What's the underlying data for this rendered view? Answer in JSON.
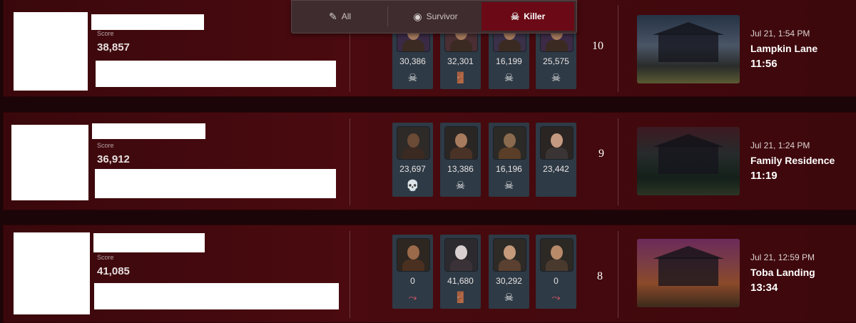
{
  "tabs": [
    {
      "label": "All",
      "icon": "all-icon",
      "active": false
    },
    {
      "label": "Survivor",
      "icon": "survivor-icon",
      "active": false
    },
    {
      "label": "Killer",
      "icon": "killer-icon",
      "active": true
    }
  ],
  "matches": [
    {
      "score_label": "Score",
      "score": "38,857",
      "rank": "10",
      "survivors": [
        {
          "points": "30,386",
          "status_icon": "sacrificed-icon",
          "status": "☠"
        },
        {
          "points": "32,301",
          "status_icon": "escaped-icon",
          "status": "🚪"
        },
        {
          "points": "16,199",
          "status_icon": "sacrificed-icon",
          "status": "☠"
        },
        {
          "points": "25,575",
          "status_icon": "sacrificed-icon",
          "status": "☠"
        }
      ],
      "date": "Jul 21, 1:54 PM",
      "map": "Lampkin Lane",
      "duration": "11:56"
    },
    {
      "score_label": "Score",
      "score": "36,912",
      "rank": "9",
      "survivors": [
        {
          "points": "23,697",
          "status_icon": "killed-icon",
          "status": "💀"
        },
        {
          "points": "13,386",
          "status_icon": "sacrificed-icon",
          "status": "☠"
        },
        {
          "points": "16,196",
          "status_icon": "sacrificed-icon",
          "status": "☠"
        },
        {
          "points": "23,442",
          "status_icon": "",
          "status": ""
        }
      ],
      "date": "Jul 21, 1:24 PM",
      "map": "Family Residence",
      "duration": "11:19"
    },
    {
      "score_label": "Score",
      "score": "41,085",
      "rank": "8",
      "survivors": [
        {
          "points": "0",
          "status_icon": "disconnected-icon",
          "status": "⤳"
        },
        {
          "points": "41,680",
          "status_icon": "escaped-icon",
          "status": "🚪"
        },
        {
          "points": "30,292",
          "status_icon": "sacrificed-icon",
          "status": "☠"
        },
        {
          "points": "0",
          "status_icon": "disconnected-icon",
          "status": "⤳"
        }
      ],
      "date": "Jul 21, 12:59 PM",
      "map": "Toba Landing",
      "duration": "13:34"
    }
  ]
}
